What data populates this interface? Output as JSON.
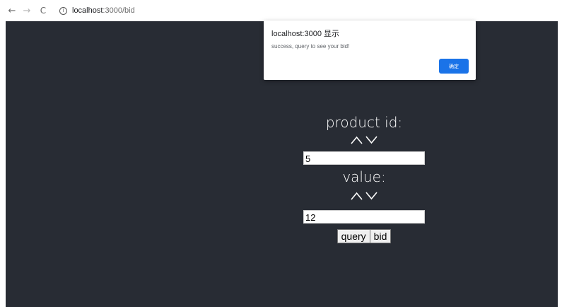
{
  "browser": {
    "back_icon": "←",
    "forward_icon": "→",
    "reload_icon": "C",
    "info_icon": "i",
    "url_host": "localhost",
    "url_path": ":3000/bid"
  },
  "form": {
    "product_label": "product id:",
    "product_value": "5",
    "value_label": "value:",
    "value_value": "12",
    "query_label": "query",
    "bid_label": "bid"
  },
  "alert": {
    "title": "localhost:3000 显示",
    "message": "success, query to see your bid!",
    "ok_label": "确定"
  },
  "colors": {
    "page_bg": "#282c34",
    "alert_button": "#1a73e8"
  }
}
